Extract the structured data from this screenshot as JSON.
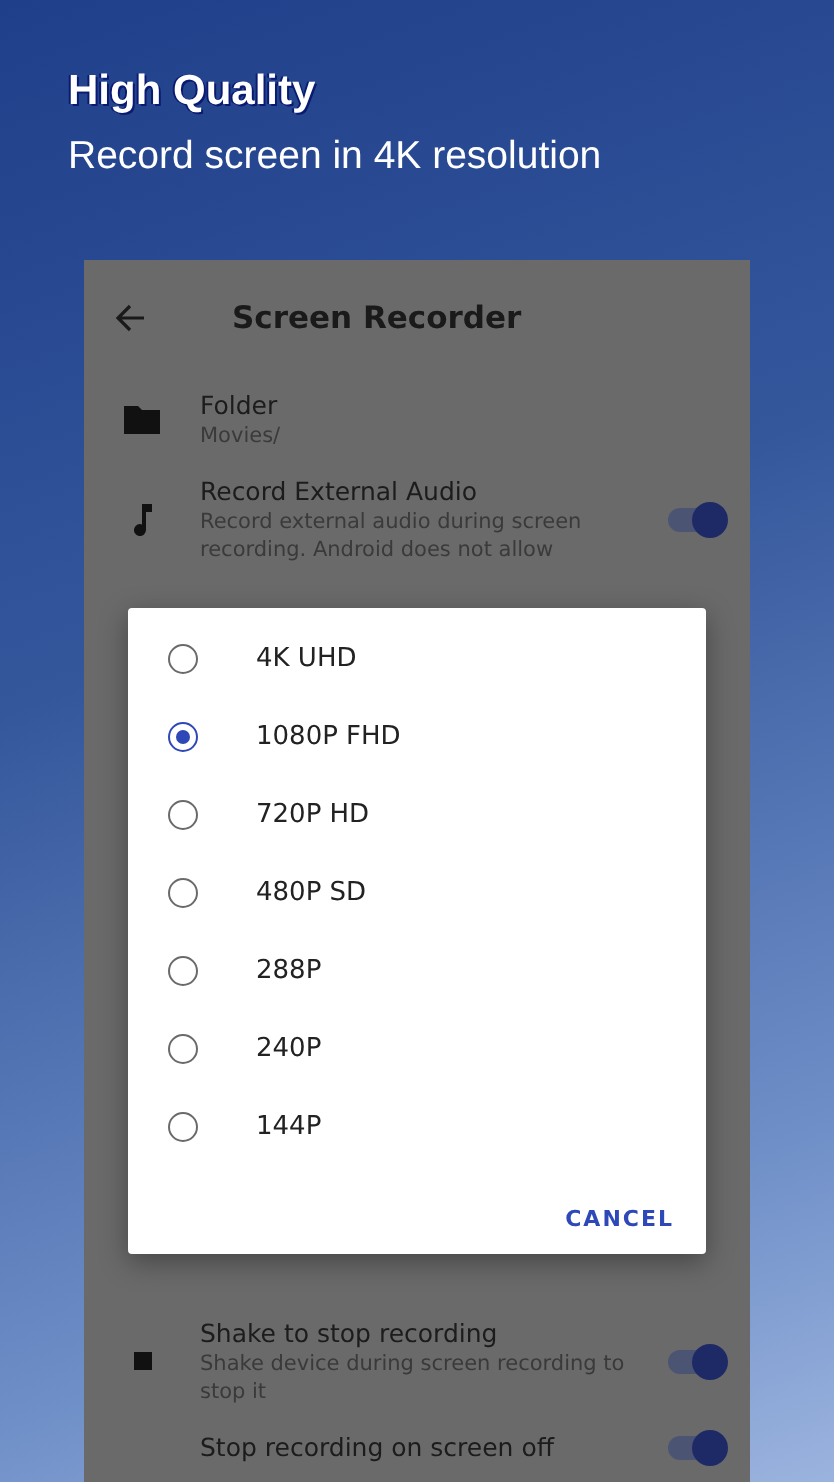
{
  "banner": {
    "title": "High Quality",
    "subtitle": "Record screen in 4K resolution"
  },
  "app_bar": {
    "title": "Screen Recorder"
  },
  "settings": [
    {
      "kind": "info",
      "title": "Folder",
      "description": "Movies/"
    },
    {
      "kind": "toggle",
      "title": "Record External Audio",
      "description": "Record external audio during screen recording. Android does not allow",
      "on": true
    },
    {
      "kind": "toggle",
      "title": "Shake to stop recording",
      "description": "Shake device during screen recording to stop it",
      "on": true
    },
    {
      "kind": "toggle",
      "title": "Stop recording on screen off",
      "on": true
    }
  ],
  "dialog": {
    "options": [
      {
        "label": "4K UHD",
        "selected": false
      },
      {
        "label": "1080P FHD",
        "selected": true
      },
      {
        "label": "720P HD",
        "selected": false
      },
      {
        "label": "480P SD",
        "selected": false
      },
      {
        "label": "288P",
        "selected": false
      },
      {
        "label": "240P",
        "selected": false
      },
      {
        "label": "144P",
        "selected": false
      }
    ],
    "buttons": [
      "CANCEL"
    ]
  }
}
